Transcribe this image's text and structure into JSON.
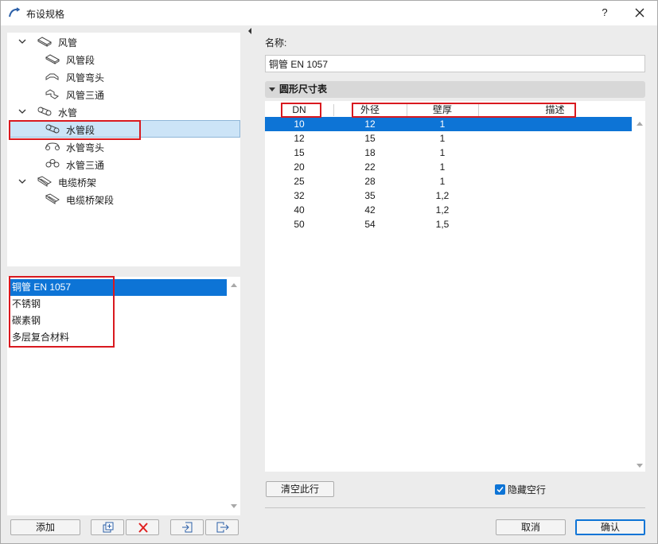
{
  "window": {
    "title": "布设规格"
  },
  "titlebar": {
    "help_label": "?"
  },
  "tree": {
    "groups": [
      {
        "label": "风管",
        "children": [
          "风管段",
          "风管弯头",
          "风管三通"
        ]
      },
      {
        "label": "水管",
        "children": [
          "水管段",
          "水管弯头",
          "水管三通"
        ]
      },
      {
        "label": "电缆桥架",
        "children": [
          "电缆桥架段"
        ]
      }
    ],
    "selected": "水管段"
  },
  "materials": {
    "items": [
      "铜管 EN 1057",
      "不锈钢",
      "碳素钢",
      "多层复合材料"
    ],
    "selected_index": 0
  },
  "left_buttons": {
    "add_label": "添加"
  },
  "name_field": {
    "label": "名称:",
    "value": "铜管 EN 1057"
  },
  "section": {
    "title": "圆形尺寸表"
  },
  "table": {
    "columns": [
      "DN",
      "外径",
      "壁厚",
      "描述"
    ],
    "rows": [
      [
        "10",
        "12",
        "1",
        ""
      ],
      [
        "12",
        "15",
        "1",
        ""
      ],
      [
        "15",
        "18",
        "1",
        ""
      ],
      [
        "20",
        "22",
        "1",
        ""
      ],
      [
        "25",
        "28",
        "1",
        ""
      ],
      [
        "32",
        "35",
        "1,2",
        ""
      ],
      [
        "40",
        "42",
        "1,2",
        ""
      ],
      [
        "50",
        "54",
        "1,5",
        ""
      ]
    ],
    "selected_row": 0
  },
  "actions": {
    "clear_row_label": "清空此行",
    "hide_empty_label": "隐藏空行",
    "hide_empty_checked": true,
    "cancel_label": "取消",
    "ok_label": "确认"
  },
  "colors": {
    "selection_blue": "#0d74d6",
    "tree_selection": "#cce4f7",
    "highlight_red": "#d9191f"
  }
}
